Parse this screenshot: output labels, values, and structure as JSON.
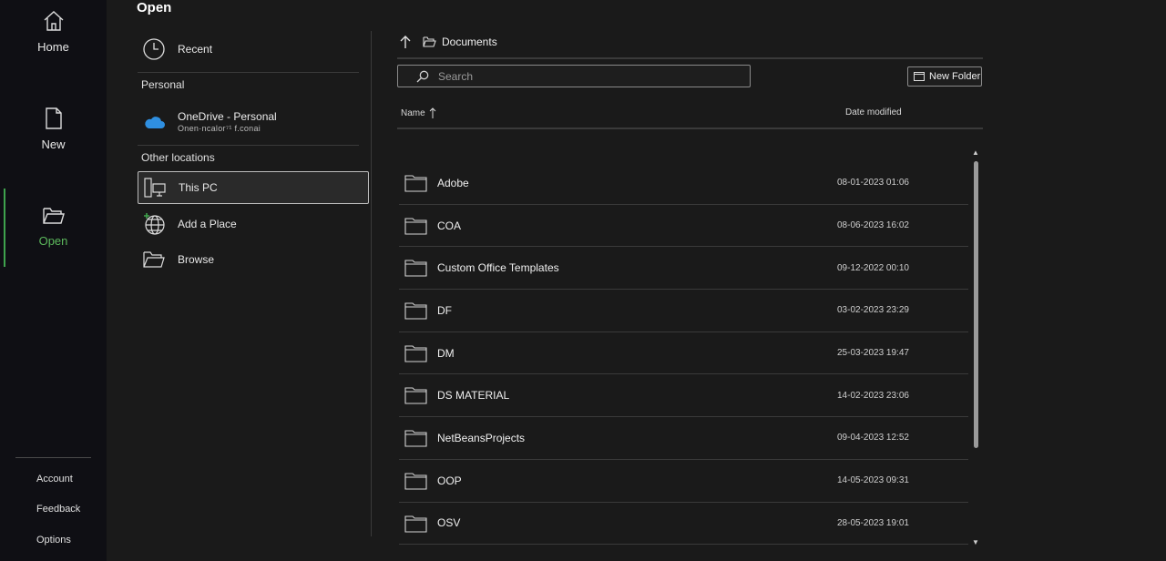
{
  "nav": {
    "items": [
      {
        "label": "Home",
        "icon": "home-icon"
      },
      {
        "label": "New",
        "icon": "new-document-icon"
      },
      {
        "label": "Open",
        "icon": "open-folder-icon",
        "active": true
      }
    ],
    "bottom": [
      "Account",
      "Feedback",
      "Options"
    ]
  },
  "page": {
    "title": "Open"
  },
  "locations": {
    "recent": "Recent",
    "personal_header": "Personal",
    "onedrive_name": "OneDrive - Personal",
    "onedrive_email": "Onen·ncalor⁷¹ f.conai",
    "other_header": "Other locations",
    "this_pc": "This PC",
    "add_place": "Add a Place",
    "browse": "Browse"
  },
  "browser": {
    "breadcrumb": "Documents",
    "search_placeholder": "Search",
    "new_folder": "New Folder",
    "col_name": "Name",
    "col_date": "Date modified",
    "folders": [
      {
        "name": "Adobe",
        "date": "08-01-2023 01:06"
      },
      {
        "name": "COA",
        "date": "08-06-2023 16:02"
      },
      {
        "name": "Custom Office Templates",
        "date": "09-12-2022 00:10"
      },
      {
        "name": "DF",
        "date": "03-02-2023 23:29"
      },
      {
        "name": "DM",
        "date": "25-03-2023 19:47"
      },
      {
        "name": "DS MATERIAL",
        "date": "14-02-2023 23:06"
      },
      {
        "name": "NetBeansProjects",
        "date": "09-04-2023 12:52"
      },
      {
        "name": "OOP",
        "date": "14-05-2023 09:31"
      },
      {
        "name": "OSV",
        "date": "28-05-2023 19:01"
      }
    ]
  },
  "colors": {
    "accent": "#3fa34d",
    "background": "#1a1a1a",
    "rail": "#0f0f14"
  }
}
